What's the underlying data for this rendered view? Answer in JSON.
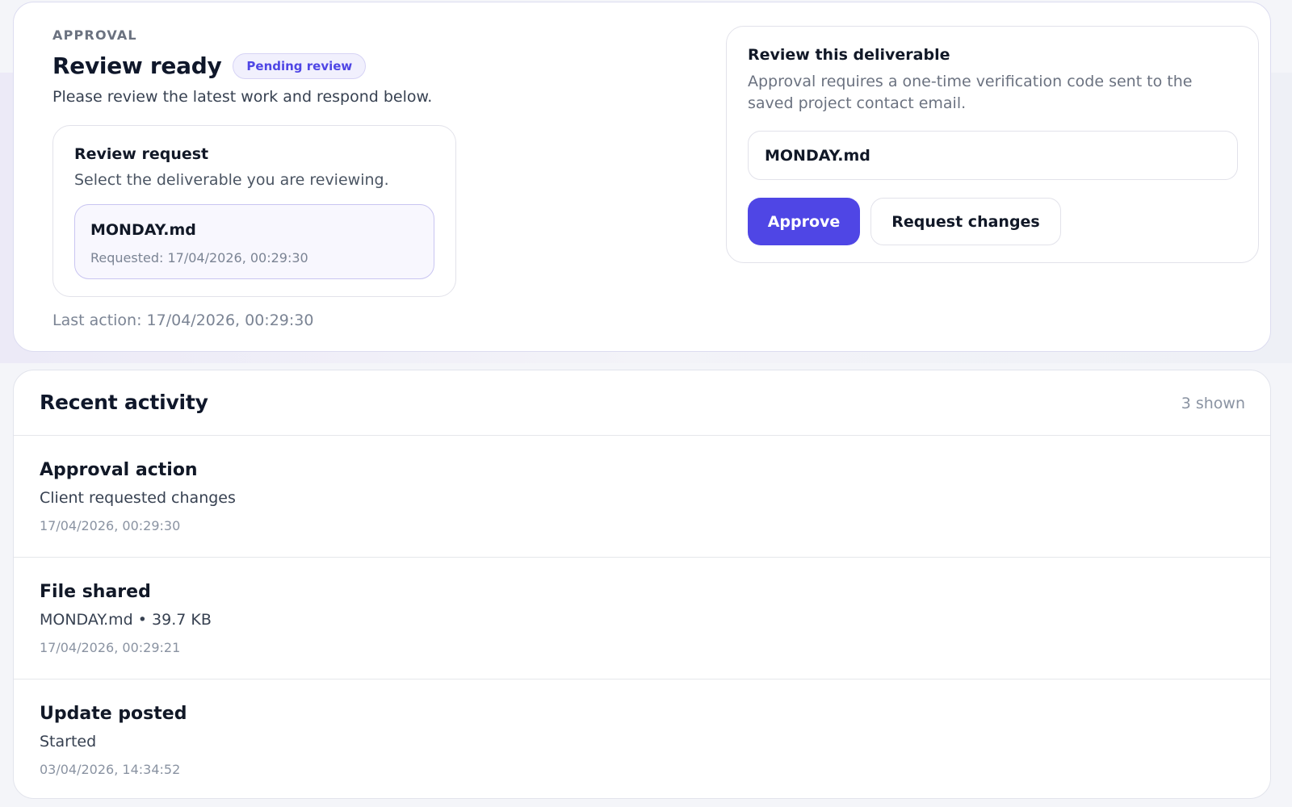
{
  "approval": {
    "eyebrow": "APPROVAL",
    "title": "Review ready",
    "status_badge": "Pending review",
    "subtitle": "Please review the latest work and respond below.",
    "review_request": {
      "title": "Review request",
      "subtitle": "Select the deliverable you are reviewing.",
      "item": {
        "name": "MONDAY.md",
        "requested": "Requested: 17/04/2026, 00:29:30"
      }
    },
    "last_action": "Last action: 17/04/2026, 00:29:30"
  },
  "deliverable": {
    "title": "Review this deliverable",
    "description": "Approval requires a one-time verification code sent to the saved project contact email.",
    "input_value": "MONDAY.md",
    "approve_label": "Approve",
    "request_changes_label": "Request changes"
  },
  "activity": {
    "title": "Recent activity",
    "count": "3 shown",
    "items": [
      {
        "title": "Approval action",
        "detail": "Client requested changes",
        "time": "17/04/2026, 00:29:30"
      },
      {
        "title": "File shared",
        "detail": "MONDAY.md • 39.7 KB",
        "time": "17/04/2026, 00:29:21"
      },
      {
        "title": "Update posted",
        "detail": "Started",
        "time": "03/04/2026, 14:34:52"
      }
    ]
  },
  "colors": {
    "accent": "#4f46e5",
    "badge_bg": "#f1f0fd",
    "selected_item_bg": "#f8f7fe"
  }
}
